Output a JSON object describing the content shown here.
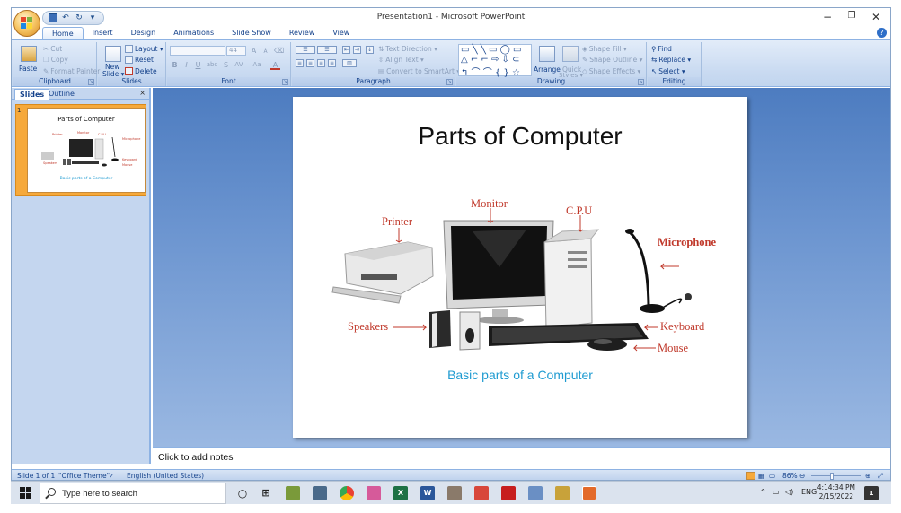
{
  "window": {
    "title": "Presentation1 - Microsoft PowerPoint",
    "controls": {
      "minimize": "−",
      "restore": "❐",
      "close": "✕"
    }
  },
  "quick_access": {
    "undo": "↶",
    "redo": "↻",
    "more": "▾"
  },
  "tabs": [
    {
      "label": "Home",
      "active": true
    },
    {
      "label": "Insert"
    },
    {
      "label": "Design"
    },
    {
      "label": "Animations"
    },
    {
      "label": "Slide Show"
    },
    {
      "label": "Review"
    },
    {
      "label": "View"
    }
  ],
  "ribbon": {
    "clipboard": {
      "label": "Clipboard",
      "paste": "Paste",
      "cut": "Cut",
      "copy": "Copy",
      "format_painter": "Format Painter"
    },
    "slides": {
      "label": "Slides",
      "new_slide": "New",
      "new_slide2": "Slide ▾",
      "layout": "Layout ▾",
      "reset": "Reset",
      "delete": "Delete"
    },
    "font": {
      "label": "Font",
      "font_size": "44",
      "grow": "A",
      "shrink": "A",
      "clear": "⌫",
      "bold": "B",
      "italic": "I",
      "underline": "U",
      "strike": "abc",
      "shadow": "S",
      "spacing": "AV",
      "case": "Aa",
      "color": "A"
    },
    "paragraph": {
      "label": "Paragraph",
      "text_direction": "Text Direction ▾",
      "align_text": "Align Text ▾",
      "convert_smartart": "Convert to SmartArt ▾"
    },
    "drawing": {
      "label": "Drawing",
      "arrange": "Arrange",
      "quick_styles": "Quick",
      "quick_styles2": "Styles ▾",
      "shape_fill": "Shape Fill ▾",
      "shape_outline": "Shape Outline ▾",
      "shape_effects": "Shape Effects ▾"
    },
    "editing": {
      "label": "Editing",
      "find": "Find",
      "replace": "Replace ▾",
      "select": "Select ▾"
    }
  },
  "left_panel": {
    "tab_slides": "Slides",
    "tab_outline": "Outline",
    "close": "×",
    "slide_number": "1"
  },
  "slide": {
    "title": "Parts of Computer",
    "labels": {
      "monitor": "Monitor",
      "cpu": "C.P.U",
      "printer": "Printer",
      "microphone": "Microphone",
      "speakers": "Speakers",
      "keyboard": "Keyboard",
      "mouse": "Mouse"
    },
    "caption": "Basic parts of a Computer"
  },
  "notes": {
    "placeholder": "Click to add notes"
  },
  "status": {
    "slide": "Slide 1 of 1",
    "theme": "\"Office Theme\"",
    "language": "English (United States)",
    "zoom": "86%",
    "zoom_minus": "⊖",
    "zoom_plus": "⊕"
  },
  "taskbar": {
    "search_placeholder": "Type here to search",
    "tray_lang": "ENG",
    "tray_up": "^",
    "time": "4:14:34 PM",
    "date": "2/15/2022",
    "notification_count": "1"
  }
}
